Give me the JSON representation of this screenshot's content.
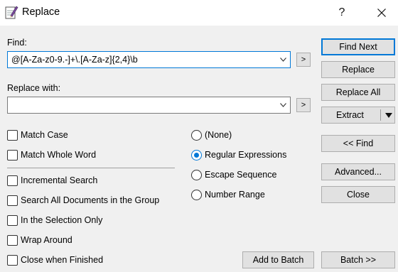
{
  "window": {
    "title": "Replace",
    "help": "?",
    "close": "✕"
  },
  "find": {
    "label": "Find:",
    "value": "@[A-Za-z0-9.-]+\\.[A-Za-z]{2,4}\\b",
    "arrow_label": ">"
  },
  "replace": {
    "label": "Replace with:",
    "value": "",
    "arrow_label": ">"
  },
  "buttons": {
    "find_next": "Find Next",
    "replace": "Replace",
    "replace_all": "Replace All",
    "extract": "Extract",
    "back_find": "<< Find",
    "advanced": "Advanced...",
    "close": "Close",
    "add_to_batch": "Add to Batch",
    "batch": "Batch >>"
  },
  "options": [
    {
      "label": "Match Case",
      "checked": false
    },
    {
      "label": "Match Whole Word",
      "checked": false
    },
    {
      "label": "Incremental Search",
      "checked": false
    },
    {
      "label": "Search All Documents in the Group",
      "checked": false
    },
    {
      "label": "In the Selection Only",
      "checked": false
    },
    {
      "label": "Wrap Around",
      "checked": false
    },
    {
      "label": "Close when Finished",
      "checked": false
    }
  ],
  "modes": [
    {
      "label": "(None)",
      "selected": false
    },
    {
      "label": "Regular Expressions",
      "selected": true
    },
    {
      "label": "Escape Sequence",
      "selected": false
    },
    {
      "label": "Number Range",
      "selected": false
    }
  ],
  "colors": {
    "accent": "#0078d7",
    "background": "#f0f0f0"
  }
}
